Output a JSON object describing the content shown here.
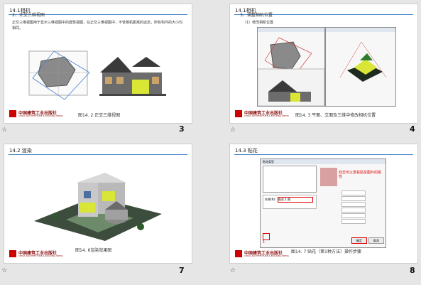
{
  "slides": [
    {
      "title": "14.1相机",
      "subtitle": "2、正交三维视图",
      "body": "正交三维视图用于显示三维视图中的建筑视图，在正交三维视图中，不管相机距离的远近，所有构件的大小均相同。",
      "caption": "图14. 2 正交三维视图",
      "number": "3"
    },
    {
      "title": "14.1相机",
      "subtitle": "3、调整相机位置",
      "subsubtitle": "（1）修改相机位置",
      "caption": "图14. 3 平面、立面及三维中修改相机位置",
      "number": "4"
    },
    {
      "title": "14.2 渲染",
      "caption": "图14. 6渲染效果图",
      "number": "7"
    },
    {
      "title": "14.3 贴花",
      "caption": "图14. 7 贴花（第1种方法）操作步骤",
      "number": "8",
      "dialog_title": "贴花类型",
      "field_name_label": "名称(N):",
      "field_name_value": "贴花 1 图",
      "ok_label": "确定",
      "cancel_label": "取消",
      "annotation": "双击可以查看贴花图片的属性"
    }
  ],
  "logo": {
    "cn": "中国建筑工业出版社",
    "en": "CHINA ARCHITECTURE & BUILDING PRESS"
  },
  "colors": {
    "accent_rule": "#4a86c8",
    "logo_red": "#8b1010",
    "house_yellow": "#d9e636"
  }
}
